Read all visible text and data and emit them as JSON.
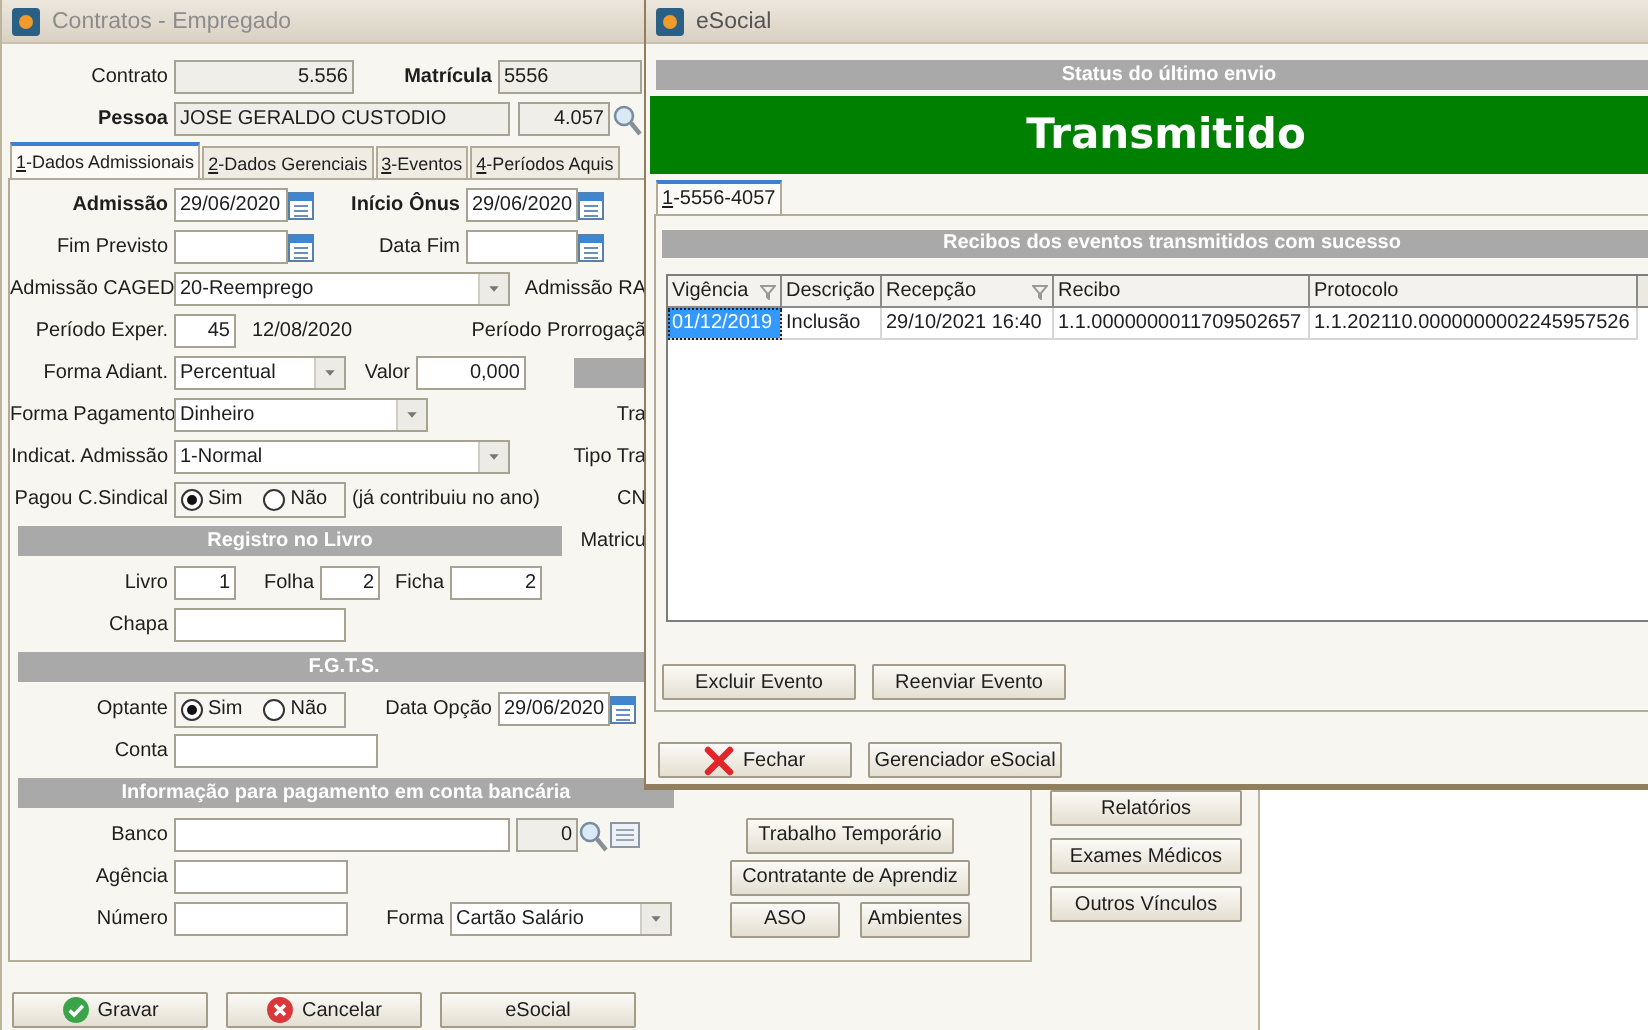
{
  "main_window": {
    "title": "Contratos - Empregado",
    "contrato": {
      "label": "Contrato",
      "value": "5.556"
    },
    "matricula": {
      "label": "Matrícula",
      "value": "5556"
    },
    "pessoa": {
      "label": "Pessoa",
      "name": "JOSE GERALDO CUSTODIO",
      "code": "4.057"
    },
    "tabs": [
      {
        "label": "1-Dados Admissionais",
        "selected": true
      },
      {
        "label": "2-Dados Gerenciais",
        "selected": false
      },
      {
        "label": "3-Eventos",
        "selected": false
      },
      {
        "label": "4-Períodos Aquis",
        "selected": false
      }
    ],
    "admissao": {
      "label": "Admissão",
      "value": "29/06/2020"
    },
    "inicio_onus": {
      "label": "Início Ônus",
      "value": "29/06/2020"
    },
    "fim_previsto": {
      "label": "Fim Previsto"
    },
    "data_fim": {
      "label": "Data Fim"
    },
    "admissao_caged": {
      "label": "Admissão CAGED",
      "value": "20-Reemprego",
      "partial_label": "Admissão RA"
    },
    "periodo_exper": {
      "label": "Período Exper.",
      "days": "45",
      "end_date": "12/08/2020",
      "partial_label": "Período Prorrogaçã"
    },
    "forma_adiant": {
      "label": "Forma Adiant.",
      "value": "Percentual"
    },
    "valor": {
      "label": "Valor",
      "value": "0,000"
    },
    "forma_pagamento": {
      "label": "Forma Pagamento",
      "value": "Dinheiro",
      "partial_label": "Tra"
    },
    "indicat_admissao": {
      "label": "Indicat. Admissão",
      "value": "1-Normal",
      "partial_label": "Tipo Tra"
    },
    "pagou_sindical": {
      "label": "Pagou C.Sindical",
      "options": [
        {
          "label": "Sim",
          "selected": true
        },
        {
          "label": "Não",
          "selected": false
        }
      ],
      "note": "(já contribuiu no ano)",
      "partial_label": "CN"
    },
    "registro_livro": {
      "title": "Registro no Livro",
      "partial_label": "Matricu",
      "livro": {
        "label": "Livro",
        "value": "1"
      },
      "folha": {
        "label": "Folha",
        "value": "2"
      },
      "ficha": {
        "label": "Ficha",
        "value": "2"
      },
      "chapa": {
        "label": "Chapa"
      }
    },
    "fgts": {
      "title": "F.G.T.S.",
      "optante": {
        "label": "Optante",
        "options": [
          {
            "label": "Sim",
            "selected": true
          },
          {
            "label": "Não",
            "selected": false
          }
        ]
      },
      "data_opcao": {
        "label": "Data Opção",
        "value": "29/06/2020"
      },
      "conta": {
        "label": "Conta"
      }
    },
    "conta_bancaria": {
      "title": "Informação para pagamento em conta bancária",
      "banco": {
        "label": "Banco",
        "code": "0"
      },
      "agencia": {
        "label": "Agência"
      },
      "numero": {
        "label": "Número"
      },
      "forma": {
        "label": "Forma",
        "value": "Cartão Salário"
      }
    },
    "panel_buttons": [
      "Trabalho Temporário",
      "Contratante de Aprendiz",
      "ASO",
      "Ambientes"
    ],
    "side_buttons": [
      "Relatórios",
      "Exames Médicos",
      "Outros Vínculos"
    ],
    "footer_buttons": [
      {
        "label": "Gravar",
        "kind": "confirm"
      },
      {
        "label": "Cancelar",
        "kind": "cancel"
      },
      {
        "label": "eSocial",
        "kind": "plain"
      }
    ]
  },
  "esocial_window": {
    "title": "eSocial",
    "status_heading": "Status do último envio",
    "status": "Transmitido",
    "tabs": [
      {
        "label": "1-5556-4057",
        "selected": true
      }
    ],
    "receipts": {
      "title": "Recibos dos eventos transmitidos com sucesso",
      "columns": [
        {
          "label": "Vigência",
          "filter": true
        },
        {
          "label": "Descrição",
          "filter": false
        },
        {
          "label": "Recepção",
          "filter": true
        },
        {
          "label": "Recibo",
          "filter": false
        },
        {
          "label": "Protocolo",
          "filter": false
        }
      ],
      "rows": [
        {
          "selected": true,
          "cells": [
            "01/12/2019",
            "Inclusão",
            "29/10/2021 16:40",
            "1.1.0000000011709502657",
            "1.1.202110.0000000002245957526"
          ]
        }
      ]
    },
    "event_buttons": [
      "Excluir Evento",
      "Reenviar Evento"
    ],
    "buttons": [
      {
        "label": "Fechar",
        "kind": "close"
      },
      {
        "label": "Gerenciador eSocial",
        "kind": "plain"
      }
    ]
  }
}
